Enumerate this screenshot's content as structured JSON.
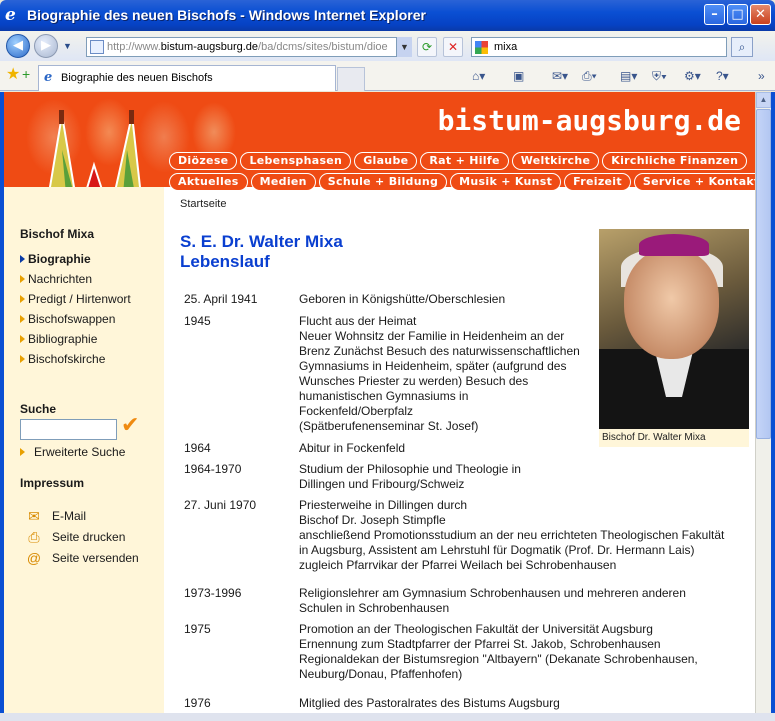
{
  "window": {
    "title": "Biographie des neuen Bischofs - Windows Internet Explorer",
    "minimize": "–",
    "maximize": "□",
    "close": "✕"
  },
  "addressbar": {
    "url_prefix": "http://www.",
    "url_domain": "bistum-augsburg.de",
    "url_path": "/ba/dcms/sites/bistum/dioe",
    "search_value": "mixa"
  },
  "tabs": {
    "active_label": "Biographie des neuen Bischofs"
  },
  "site": {
    "title": "bistum-augsburg.de",
    "breadcrumb": "Startseite",
    "nav_row1": [
      "Diözese",
      "Lebensphasen",
      "Glaube",
      "Rat + Hilfe",
      "Weltkirche",
      "Kirchliche Finanzen"
    ],
    "nav_row2": [
      "Aktuelles",
      "Medien",
      "Schule + Bildung",
      "Musik + Kunst",
      "Freizeit",
      "Service + Kontakt"
    ]
  },
  "sidebar": {
    "section_title": "Bischof Mixa",
    "items": [
      "Biographie",
      "Nachrichten",
      "Predigt / Hirtenwort",
      "Bischofswappen",
      "Bibliographie",
      "Bischofskirche"
    ],
    "search_title": "Suche",
    "advanced_search": "Erweiterte Suche",
    "impressum": "Impressum",
    "tools": [
      {
        "label": "E-Mail",
        "icon": "email-icon"
      },
      {
        "label": "Seite drucken",
        "icon": "print-icon"
      },
      {
        "label": "Seite versenden",
        "icon": "send-icon"
      }
    ]
  },
  "content": {
    "title_line1": "S. E. Dr. Walter Mixa",
    "title_line2": "Lebenslauf",
    "photo_caption": "Bischof Dr. Walter Mixa",
    "rows": [
      {
        "date": "25. April 1941",
        "text": "Geboren in Königshütte/Oberschlesien"
      },
      {
        "date": "1945",
        "text": "Flucht aus der Heimat\nNeuer Wohnsitz der Familie in Heidenheim an der\nBrenz Zunächst Besuch des naturwissenschaftlichen\nGymnasiums in Heidenheim, später (aufgrund des\nWunsches Priester zu werden) Besuch des\nhumanistischen Gymnasiums in\nFockenfeld/Oberpfalz\n(Spätberufenenseminar St. Josef)"
      },
      {
        "date": "1964",
        "text": "Abitur in Fockenfeld"
      },
      {
        "date": "1964-1970",
        "text": "Studium der Philosophie und Theologie in\nDillingen und Fribourg/Schweiz"
      },
      {
        "date": "27. Juni 1970",
        "text": "Priesterweihe in Dillingen durch\nBischof Dr. Joseph Stimpfle\nanschließend Promotionsstudium an der neu errichteten Theologischen Fakultät\nin Augsburg, Assistent am Lehrstuhl für Dogmatik (Prof. Dr. Hermann Lais)\nzugleich Pfarrvikar der Pfarrei Weilach bei Schrobenhausen"
      },
      {
        "date": "1973-1996",
        "text": "Religionslehrer am Gymnasium Schrobenhausen und mehreren anderen\nSchulen in Schrobenhausen"
      },
      {
        "date": "1975",
        "text": "Promotion an der Theologischen Fakultät der Universität Augsburg\nErnennung zum Stadtpfarrer der Pfarrei St. Jakob, Schrobenhausen\nRegionaldekan der Bistumsregion \"Altbayern\" (Dekanate Schrobenhausen,\nNeuburg/Donau, Pfaffenhofen)"
      },
      {
        "date": "1976",
        "text": "Mitglied des Pastoralrates des Bistums Augsburg"
      }
    ]
  },
  "colors": {
    "accent_orange": "#ef4b14",
    "sidebar_bg": "#fff6d9",
    "title_blue": "#0a3fd0"
  }
}
